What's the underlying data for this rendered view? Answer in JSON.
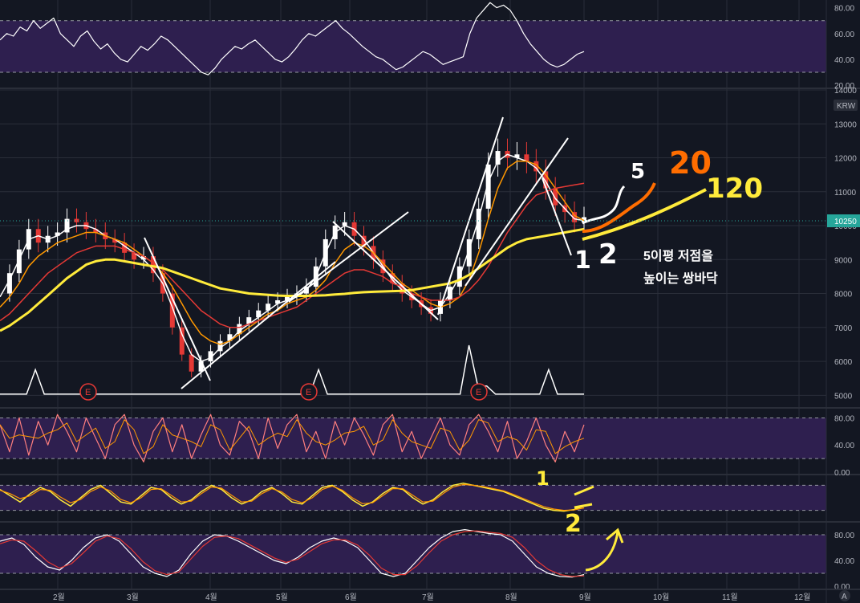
{
  "colors": {
    "background": "#131722",
    "band": "#2e1f4f",
    "grid": "#2a2e39",
    "price": "#ffffff",
    "ma5": "#ffffff",
    "ma20": "#ff9800",
    "ma60": "#e53935",
    "ma120": "#ffeb3b",
    "volume": "#ffffff",
    "osc_main": "#ffffff",
    "osc_signal": "#e53935",
    "stoch_main": "#ffeb3b",
    "stoch_signal": "#ff9800",
    "annot_orange": "#ff6d00",
    "annot_yellow": "#ffeb3b",
    "current_price_bg": "#26a69a"
  },
  "chart_data": [
    {
      "type": "line",
      "name": "rsi-panel",
      "yticks": [
        "80.00",
        "60.00",
        "40.00",
        "20.00"
      ],
      "ylim": [
        20,
        86
      ],
      "band": [
        30,
        70
      ],
      "values": [
        55,
        60,
        58,
        65,
        62,
        70,
        64,
        68,
        72,
        60,
        55,
        50,
        58,
        62,
        54,
        48,
        52,
        45,
        40,
        38,
        44,
        50,
        47,
        52,
        58,
        55,
        50,
        45,
        40,
        35,
        30,
        28,
        33,
        40,
        45,
        50,
        48,
        52,
        55,
        50,
        45,
        40,
        38,
        42,
        48,
        55,
        60,
        58,
        62,
        66,
        70,
        64,
        60,
        55,
        50,
        46,
        42,
        40,
        36,
        32,
        34,
        38,
        42,
        46,
        44,
        40,
        36,
        38,
        40,
        42,
        60,
        72,
        78,
        84,
        80,
        82,
        78,
        70,
        60,
        52,
        46,
        40,
        36,
        34,
        36,
        40,
        44,
        46
      ]
    },
    {
      "type": "line",
      "name": "price-panel",
      "currency": "KRW",
      "current_price": "10250",
      "yticks": [
        "14000",
        "13000",
        "12000",
        "11000",
        "10000",
        "9000",
        "8000",
        "7000",
        "6000",
        "5000"
      ],
      "ylim": [
        4700,
        14000
      ],
      "xticks": [
        "2월",
        "3월",
        "4월",
        "5월",
        "6월",
        "7월",
        "8월",
        "9월",
        "10월",
        "11월",
        "12월"
      ],
      "event_labels": [
        "E",
        "E",
        "E"
      ],
      "series": [
        {
          "id": "price",
          "values": [
            8000,
            8600,
            9300,
            9900,
            9500,
            9700,
            9800,
            10200,
            10100,
            9900,
            9800,
            9600,
            9500,
            9200,
            9000,
            9100,
            8600,
            8000,
            7000,
            6200,
            5700,
            6000,
            6300,
            6600,
            6800,
            7100,
            7300,
            7500,
            7700,
            7800,
            7900,
            8000,
            8200,
            8800,
            9600,
            10000,
            10100,
            9700,
            9400,
            9000,
            8600,
            8300,
            8000,
            7800,
            7600,
            7400,
            7800,
            8200,
            8800,
            9600,
            10500,
            11800,
            12200,
            12000,
            12100,
            11900,
            11600,
            11100,
            10600,
            10400,
            10100,
            10250
          ]
        },
        {
          "id": "ma5",
          "values": [
            7900,
            8400,
            9000,
            9600,
            9700,
            9600,
            9700,
            9900,
            10000,
            10000,
            9900,
            9700,
            9600,
            9400,
            9200,
            9000,
            8700,
            8300,
            7600,
            6800,
            6200,
            6000,
            6100,
            6400,
            6600,
            6900,
            7100,
            7300,
            7500,
            7700,
            7800,
            7900,
            8100,
            8500,
            9200,
            9800,
            10000,
            9900,
            9600,
            9200,
            8800,
            8400,
            8100,
            7900,
            7700,
            7500,
            7600,
            8000,
            8500,
            9300,
            10200,
            11300,
            11900,
            12100,
            12000,
            11900,
            11700,
            11300,
            10800,
            10500,
            10200,
            10150
          ]
        },
        {
          "id": "ma20",
          "values": [
            7600,
            7900,
            8300,
            8800,
            9100,
            9300,
            9500,
            9600,
            9700,
            9800,
            9800,
            9700,
            9600,
            9500,
            9300,
            9100,
            8900,
            8600,
            8200,
            7700,
            7200,
            6800,
            6600,
            6500,
            6600,
            6800,
            7000,
            7200,
            7400,
            7500,
            7700,
            7800,
            7900,
            8100,
            8400,
            8900,
            9300,
            9500,
            9400,
            9200,
            8900,
            8600,
            8300,
            8100,
            7900,
            7700,
            7600,
            7700,
            7900,
            8400,
            9200,
            10200,
            11100,
            11700,
            11900,
            11900,
            11800,
            11500,
            11100,
            10700,
            10300,
            10150
          ]
        },
        {
          "id": "ma60",
          "values": [
            7200,
            7400,
            7700,
            8000,
            8300,
            8600,
            8800,
            9000,
            9200,
            9300,
            9400,
            9400,
            9400,
            9300,
            9200,
            9100,
            8900,
            8700,
            8400,
            8100,
            7800,
            7500,
            7300,
            7100,
            7000,
            7000,
            7100,
            7200,
            7300,
            7400,
            7500,
            7600,
            7800,
            8000,
            8200,
            8400,
            8600,
            8700,
            8700,
            8600,
            8500,
            8300,
            8200,
            8000,
            7900,
            7800,
            7800,
            7800,
            7900,
            8100,
            8400,
            8800,
            9300,
            9800,
            10200,
            10600,
            10900,
            11000,
            11100,
            11150,
            11200,
            11250
          ]
        },
        {
          "id": "ma120",
          "values": [
            6900,
            7050,
            7250,
            7450,
            7700,
            7950,
            8200,
            8450,
            8650,
            8850,
            8950,
            9000,
            9000,
            8950,
            8900,
            8850,
            8800,
            8750,
            8650,
            8550,
            8450,
            8350,
            8250,
            8150,
            8100,
            8050,
            8000,
            7980,
            7960,
            7940,
            7930,
            7930,
            7930,
            7940,
            7950,
            7970,
            7990,
            8020,
            8040,
            8050,
            8060,
            8070,
            8080,
            8100,
            8150,
            8200,
            8250,
            8300,
            8400,
            8550,
            8750,
            8950,
            9150,
            9350,
            9500,
            9600,
            9650,
            9700,
            9750,
            9800,
            9850,
            9900
          ]
        }
      ]
    },
    {
      "type": "bar",
      "name": "volume",
      "values": [
        1,
        1,
        1,
        1,
        4,
        1,
        1,
        1,
        1,
        1,
        1,
        1,
        1,
        1,
        1,
        1,
        1,
        1,
        1,
        1,
        1,
        1,
        1,
        1,
        1,
        1,
        1,
        1,
        1,
        1,
        1,
        1,
        1,
        1,
        1,
        1,
        4,
        1,
        1,
        1,
        1,
        1,
        1,
        1,
        1,
        1,
        1,
        1,
        1,
        1,
        1,
        1,
        1,
        7,
        2,
        2,
        1,
        1,
        1,
        1,
        1,
        1,
        4,
        1,
        1,
        1,
        1
      ]
    },
    {
      "type": "line",
      "name": "stochastic-fast",
      "yticks": [
        "80.00",
        "40.00",
        "0.00"
      ],
      "ylim": [
        0,
        90
      ],
      "band": [
        20,
        80
      ],
      "values": [
        70,
        30,
        80,
        25,
        75,
        40,
        85,
        60,
        30,
        80,
        50,
        20,
        70,
        85,
        40,
        15,
        60,
        80,
        30,
        70,
        20,
        55,
        85,
        40,
        25,
        75,
        60,
        20,
        80,
        35,
        70,
        85,
        30,
        60,
        20,
        75,
        40,
        80,
        55,
        25,
        70,
        85,
        30,
        60,
        20,
        50,
        80,
        40,
        25,
        70,
        85,
        60,
        30,
        75,
        20,
        45,
        80,
        40,
        15,
        60,
        30,
        70
      ]
    },
    {
      "type": "line",
      "name": "stochastic-slow",
      "yticks": [],
      "ylim": [
        0,
        100
      ],
      "band": [
        20,
        80
      ],
      "series": [
        {
          "id": "slow-k",
          "values": [
            70,
            55,
            40,
            60,
            75,
            65,
            45,
            30,
            50,
            70,
            80,
            60,
            40,
            35,
            55,
            75,
            70,
            50,
            35,
            45,
            65,
            80,
            70,
            50,
            35,
            45,
            65,
            75,
            60,
            40,
            35,
            55,
            75,
            80,
            65,
            45,
            30,
            40,
            60,
            75,
            70,
            50,
            35,
            45,
            65,
            80,
            85,
            80,
            75,
            70,
            65,
            55,
            45,
            35,
            25,
            20,
            18,
            22,
            30
          ]
        },
        {
          "id": "slow-d",
          "values": [
            68,
            60,
            48,
            55,
            70,
            68,
            52,
            38,
            46,
            65,
            76,
            66,
            46,
            38,
            50,
            70,
            72,
            56,
            40,
            42,
            60,
            76,
            73,
            56,
            40,
            42,
            60,
            72,
            64,
            46,
            38,
            50,
            70,
            78,
            68,
            50,
            36,
            38,
            55,
            72,
            72,
            56,
            40,
            42,
            60,
            76,
            82,
            80,
            77,
            72,
            67,
            58,
            48,
            38,
            29,
            23,
            20,
            21,
            26
          ]
        }
      ]
    },
    {
      "type": "line",
      "name": "stochastic-rsi",
      "yticks": [
        "80.00",
        "40.00",
        "0.00"
      ],
      "ylim": [
        0,
        95
      ],
      "band": [
        20,
        80
      ],
      "series": [
        {
          "id": "stoch-k",
          "values": [
            70,
            75,
            65,
            45,
            30,
            25,
            40,
            60,
            75,
            80,
            70,
            50,
            30,
            20,
            15,
            25,
            50,
            70,
            80,
            78,
            70,
            60,
            50,
            40,
            35,
            45,
            60,
            70,
            75,
            70,
            60,
            40,
            20,
            15,
            20,
            40,
            60,
            75,
            85,
            88,
            85,
            82,
            80,
            70,
            50,
            30,
            20,
            15,
            14,
            18
          ]
        },
        {
          "id": "stoch-d",
          "values": [
            66,
            72,
            70,
            55,
            38,
            28,
            35,
            52,
            70,
            78,
            74,
            58,
            38,
            24,
            18,
            22,
            42,
            62,
            76,
            78,
            74,
            64,
            54,
            44,
            37,
            42,
            54,
            66,
            72,
            72,
            64,
            48,
            28,
            18,
            18,
            32,
            52,
            70,
            80,
            85,
            86,
            84,
            82,
            76,
            60,
            40,
            26,
            18,
            15,
            16
          ]
        }
      ]
    }
  ],
  "annotations": {
    "note_line1": "5이평 저점을",
    "note_line2": "높이는 쌍바닥",
    "hand_5": "5",
    "hand_20": "20",
    "hand_120": "120",
    "hand_1": "1",
    "hand_2": "2",
    "hand_stoch_1": "1",
    "hand_stoch_2": "2"
  },
  "footer": {
    "auto_label": "A"
  }
}
